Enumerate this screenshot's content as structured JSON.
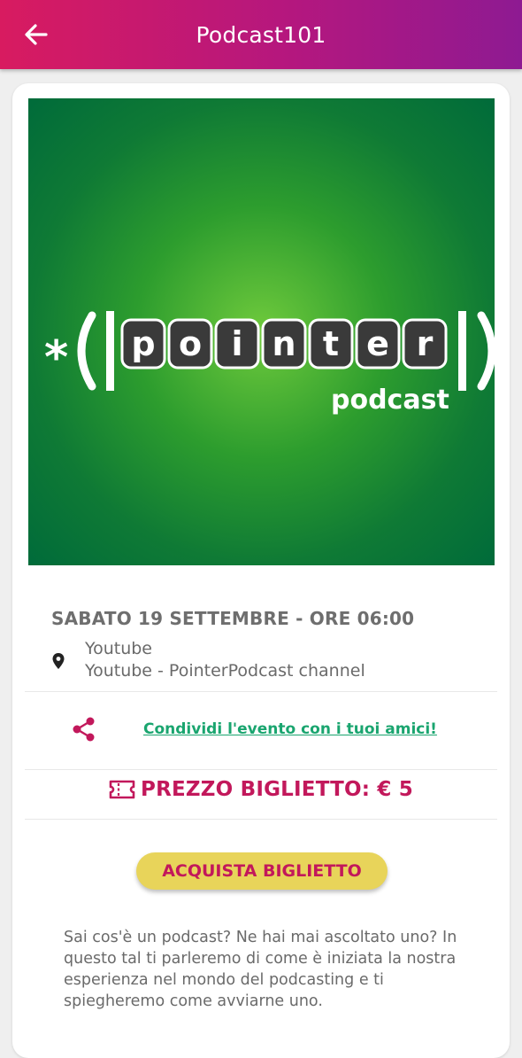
{
  "header": {
    "title": "Podcast101",
    "back_icon": "arrow-left-icon"
  },
  "cover": {
    "logo_text": "pointer",
    "logo_subtext": "podcast",
    "logo_prefix": "*",
    "background_color": "#0f7a35"
  },
  "event": {
    "date_time": "SABATO 19 SETTEMBRE - ORE 06:00",
    "location_name": "Youtube",
    "location_detail": "Youtube - PointerPodcast channel",
    "location_icon": "map-pin-icon"
  },
  "share": {
    "icon": "share-icon",
    "label": "Condividi l'evento con i tuoi amici!"
  },
  "price": {
    "icon": "ticket-icon",
    "label": "PREZZO BIGLIETTO: € 5"
  },
  "buy_button": {
    "label": "ACQUISTA BIGLIETTO"
  },
  "description": "Sai cos'è un podcast? Ne hai mai ascoltato uno? In questo tal ti parleremo di come è iniziata la nostra esperienza nel mondo del podcasting e ti spiegheremo come avviarne uno.",
  "colors": {
    "header_start": "#d81b60",
    "header_end": "#8e1a92",
    "accent": "#c2185b",
    "link": "#1aa56f",
    "button": "#e8d45a"
  }
}
